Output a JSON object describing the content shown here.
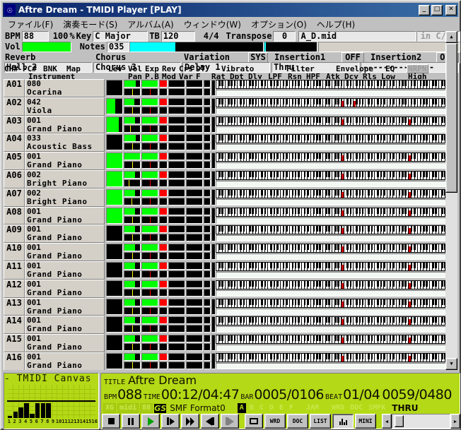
{
  "window": {
    "title": "Aftre Dream - TMIDI Player [PLAY]",
    "icon": "app-icon",
    "buttons": {
      "minimize": "_",
      "maximize": "□",
      "close": "✕"
    }
  },
  "menu": {
    "items": [
      {
        "label": "ファイル(F)",
        "name": "menu-file"
      },
      {
        "label": "演奏モード(S)",
        "name": "menu-play-mode"
      },
      {
        "label": "アルバム(A)",
        "name": "menu-album"
      },
      {
        "label": "ウィンドウ(W)",
        "name": "menu-window"
      },
      {
        "label": "オプション(O)",
        "name": "menu-option"
      },
      {
        "label": "ヘルプ(H)",
        "name": "menu-help"
      }
    ]
  },
  "control_panel": {
    "bpm_label": "BPM",
    "bpm_value": "88",
    "tempo_percent": "100",
    "percent_sign": "%",
    "key_label": "Key",
    "key_value": "C Major",
    "tb_label": "TB",
    "tb_value": "120",
    "timesig": "4/4",
    "transpose_label": "Transpose",
    "transpose_value": "0",
    "filename": "A_D.mid",
    "key_detect": "in C/Am",
    "vol_label": "Vol",
    "vol_percent": 100,
    "notes_label": "Notes",
    "notes_value": "035",
    "reverb_label": "Reverb",
    "reverb_value": "Hall 2",
    "chorus_label": "Chorus",
    "chorus_value": "Chorus 3",
    "variation_label": "Variation",
    "variation_value": "Delay 1",
    "sys_label": "SYS",
    "insertion1_label": "Insertion1",
    "insertion1_state": "OFF",
    "insertion1_value": "Thru",
    "insertion2_label": "Insertion2",
    "insertion2_state": "OFF",
    "insertion2_value": "--------------"
  },
  "columns": {
    "row1": [
      "CH#",
      "PC#",
      "BNK",
      "Map",
      "Lev",
      "Vol",
      "Exp",
      "Rev",
      "Crs",
      "DT",
      "Vibrato",
      "Filter",
      "Envelope",
      "EQ",
      "NRPN"
    ],
    "row2": [
      "Instrument",
      "Pan",
      "P.B",
      "Mod",
      "Var",
      "F",
      "Rat",
      "Dpt",
      "Dly",
      "LPF",
      "Rsn",
      "HPF",
      "Atk",
      "Dcy",
      "Rls",
      "Low",
      "High"
    ]
  },
  "channels": [
    {
      "id": "A01",
      "pc": "080",
      "name": "Ocarina",
      "lev": 0,
      "vol": 72,
      "exp": 100,
      "pan": 50,
      "mod": 45,
      "notes": []
    },
    {
      "id": "A02",
      "pc": "042",
      "name": "Viola",
      "lev": 55,
      "vol": 62,
      "exp": 100,
      "pan": 50,
      "mod": 45,
      "notes": [
        41,
        45
      ]
    },
    {
      "id": "A03",
      "pc": "001",
      "name": "Grand Piano",
      "lev": 78,
      "vol": 66,
      "exp": 100,
      "pan": 38,
      "mod": 45,
      "notes": [
        41,
        63
      ]
    },
    {
      "id": "A04",
      "pc": "033",
      "name": "Acoustic Bass",
      "lev": 0,
      "vol": 72,
      "exp": 100,
      "pan": 50,
      "mod": 45,
      "notes": []
    },
    {
      "id": "A05",
      "pc": "001",
      "name": "Grand Piano",
      "lev": 100,
      "vol": 100,
      "exp": 100,
      "pan": 50,
      "mod": 45,
      "notes": [
        41,
        63
      ]
    },
    {
      "id": "A06",
      "pc": "002",
      "name": "Bright Piano",
      "lev": 100,
      "vol": 68,
      "exp": 100,
      "pan": 28,
      "mod": 45,
      "notes": [
        41,
        63
      ]
    },
    {
      "id": "A07",
      "pc": "002",
      "name": "Bright Piano",
      "lev": 100,
      "vol": 68,
      "exp": 100,
      "pan": 45,
      "mod": 45,
      "notes": [
        41,
        63
      ]
    },
    {
      "id": "A08",
      "pc": "001",
      "name": "Grand Piano",
      "lev": 100,
      "vol": 66,
      "exp": 100,
      "pan": 50,
      "mod": 45,
      "notes": [
        41,
        63
      ]
    },
    {
      "id": "A09",
      "pc": "001",
      "name": "Grand Piano",
      "lev": 0,
      "vol": 66,
      "exp": 100,
      "pan": 50,
      "mod": 45,
      "notes": [
        41,
        63
      ]
    },
    {
      "id": "A10",
      "pc": "001",
      "name": "Grand Piano",
      "lev": 0,
      "vol": 66,
      "exp": 100,
      "pan": 50,
      "mod": 45,
      "notes": [
        41,
        63
      ]
    },
    {
      "id": "A11",
      "pc": "001",
      "name": "Grand Piano",
      "lev": 0,
      "vol": 66,
      "exp": 100,
      "pan": 50,
      "mod": 45,
      "notes": [
        41,
        63
      ]
    },
    {
      "id": "A12",
      "pc": "001",
      "name": "Grand Piano",
      "lev": 0,
      "vol": 66,
      "exp": 100,
      "pan": 50,
      "mod": 45,
      "notes": [
        41,
        63
      ]
    },
    {
      "id": "A13",
      "pc": "001",
      "name": "Grand Piano",
      "lev": 0,
      "vol": 66,
      "exp": 100,
      "pan": 50,
      "mod": 45,
      "notes": [
        41,
        63
      ]
    },
    {
      "id": "A14",
      "pc": "001",
      "name": "Grand Piano",
      "lev": 0,
      "vol": 66,
      "exp": 100,
      "pan": 50,
      "mod": 45,
      "notes": [
        41,
        63
      ]
    },
    {
      "id": "A15",
      "pc": "001",
      "name": "Grand Piano",
      "lev": 0,
      "vol": 66,
      "exp": 100,
      "pan": 50,
      "mod": 45,
      "notes": [
        41,
        63
      ]
    },
    {
      "id": "A16",
      "pc": "001",
      "name": "Grand Piano",
      "lev": 0,
      "vol": 66,
      "exp": 100,
      "pan": 50,
      "mod": 45,
      "notes": [
        41,
        63
      ]
    }
  ],
  "canvas": {
    "title": "- TMIDI Canvas -",
    "channel_labels": [
      "1",
      "2",
      "3",
      "4",
      "5",
      "6",
      "7",
      "8",
      "9",
      "10",
      "11",
      "12",
      "13",
      "14",
      "15",
      "16"
    ],
    "levels": [
      1,
      3,
      5,
      7,
      2,
      7,
      7,
      7,
      0,
      0,
      0,
      0,
      0,
      0,
      0,
      0
    ]
  },
  "info": {
    "title_label": "TITLE",
    "title_value": "Aftre Dream",
    "bpm_label": "BPM",
    "bpm_value": "088",
    "time_label": "TIME",
    "time_value": "00:12/04:47",
    "bar_label": "BAR",
    "bar_value": "0005/0106",
    "beat_label": "BEAT",
    "beat_value": "01/04",
    "tick_value": "0059/0480",
    "badges": [
      {
        "label": "XG",
        "active": false,
        "name": "badge-xg"
      },
      {
        "label": "midi",
        "active": false,
        "name": "badge-midi"
      },
      {
        "label": "88",
        "active": false,
        "name": "badge-88"
      }
    ],
    "gs_logo": "GS",
    "format_label": "SMF Format0",
    "port_badges": [
      {
        "label": "A",
        "active": true,
        "name": "badge-port-a"
      },
      {
        "label": "B",
        "active": false,
        "name": "badge-port-b"
      },
      {
        "label": "C",
        "active": false,
        "name": "badge-port-c"
      },
      {
        "label": "D",
        "active": false,
        "name": "badge-port-d"
      },
      {
        "label": "E",
        "active": false,
        "name": "badge-port-e"
      },
      {
        "label": "F",
        "active": false,
        "name": "badge-port-f"
      }
    ],
    "mode_badges": [
      {
        "label": "JAM",
        "active": false,
        "name": "badge-jam"
      },
      {
        "label": "WRD",
        "active": false,
        "name": "badge-wrd"
      },
      {
        "label": "DOC",
        "active": false,
        "name": "badge-doc"
      },
      {
        "label": "SMFK",
        "active": false,
        "name": "badge-smfk"
      }
    ],
    "thru_label": "THRU"
  },
  "transport": {
    "buttons": [
      {
        "name": "stop-button",
        "icon": "stop-icon",
        "label": ""
      },
      {
        "name": "pause-button",
        "icon": "pause-icon",
        "label": ""
      },
      {
        "name": "play-button",
        "icon": "play-icon",
        "label": ""
      },
      {
        "name": "step-forward-button",
        "icon": "step-forward-icon",
        "label": ""
      },
      {
        "name": "fast-forward-button",
        "icon": "fast-forward-icon",
        "label": ""
      },
      {
        "name": "prev-track-button",
        "icon": "prev-track-icon",
        "label": ""
      },
      {
        "name": "next-track-button",
        "icon": "next-track-icon",
        "label": ""
      },
      {
        "name": "window-button",
        "icon": "window-icon",
        "label": ""
      },
      {
        "name": "wrd-button",
        "icon": "",
        "label": "WRD"
      },
      {
        "name": "doc-button",
        "icon": "",
        "label": "DOC"
      },
      {
        "name": "list-button",
        "icon": "",
        "label": "LIST"
      },
      {
        "name": "mixer-button",
        "icon": "equalizer-icon",
        "label": ""
      },
      {
        "name": "mini-button",
        "icon": "",
        "label": "MINI"
      }
    ],
    "position_percent": 4
  }
}
